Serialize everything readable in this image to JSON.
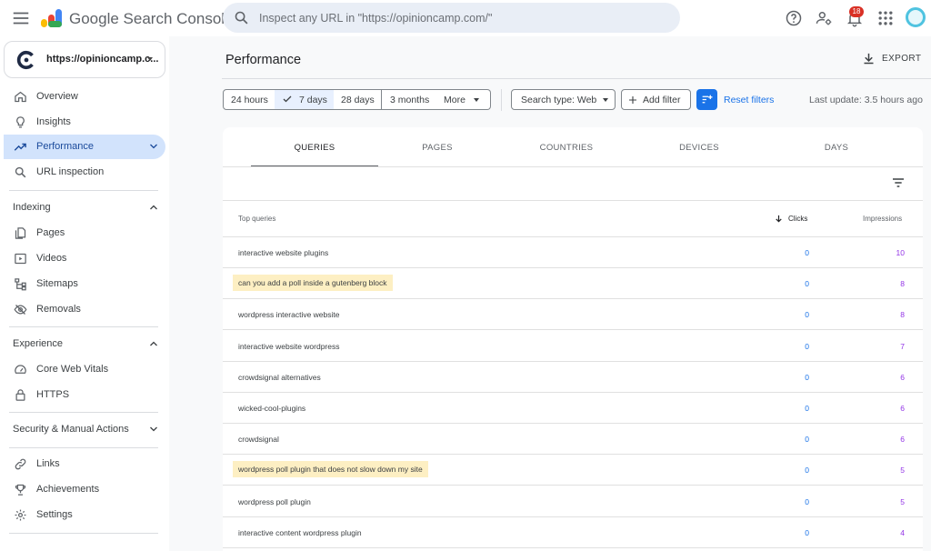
{
  "header": {
    "brand": "Google Search Console",
    "search_placeholder": "Inspect any URL in \"https://opinioncamp.com/\"",
    "notification_count": "18",
    "icons": [
      "menu-icon",
      "help-icon",
      "manage-users-icon",
      "notifications-icon",
      "apps-icon",
      "avatar"
    ]
  },
  "sidebar": {
    "property_label": "https://opinioncamp.c...",
    "items": [
      {
        "label": "Overview",
        "icon": "home-icon"
      },
      {
        "label": "Insights",
        "icon": "insights-icon"
      },
      {
        "label": "Performance",
        "icon": "trending-icon",
        "active": true
      },
      {
        "label": "URL inspection",
        "icon": "search-icon"
      }
    ],
    "sections": [
      {
        "label": "Indexing",
        "items": [
          "Pages",
          "Videos",
          "Sitemaps",
          "Removals"
        ]
      },
      {
        "label": "Experience",
        "items": [
          "Core Web Vitals",
          "HTTPS"
        ]
      },
      {
        "label": "Security & Manual Actions"
      }
    ],
    "bottom_items": [
      "Links",
      "Achievements",
      "Settings"
    ]
  },
  "main": {
    "title": "Performance",
    "export_label": "EXPORT",
    "date_ranges": [
      "24 hours",
      "7 days",
      "28 days",
      "3 months",
      "More"
    ],
    "selected_range": "7 days",
    "search_type": "Search type: Web",
    "add_filter": "Add filter",
    "reset_filters": "Reset filters",
    "last_update": "Last update: 3.5 hours ago"
  },
  "table": {
    "tabs": [
      "QUERIES",
      "PAGES",
      "COUNTRIES",
      "DEVICES",
      "DAYS"
    ],
    "active_tab": "QUERIES",
    "columns": [
      "Top queries",
      "Clicks",
      "Impressions"
    ],
    "rows": [
      {
        "query": "interactive website plugins",
        "clicks": "0",
        "impressions": "10"
      },
      {
        "query": "can you add a poll inside a gutenberg block",
        "clicks": "0",
        "impressions": "8",
        "highlight": true
      },
      {
        "query": "wordpress interactive website",
        "clicks": "0",
        "impressions": "8"
      },
      {
        "query": "interactive website wordpress",
        "clicks": "0",
        "impressions": "7"
      },
      {
        "query": "crowdsignal alternatives",
        "clicks": "0",
        "impressions": "6"
      },
      {
        "query": "wicked-cool-plugins",
        "clicks": "0",
        "impressions": "6"
      },
      {
        "query": "crowdsignal",
        "clicks": "0",
        "impressions": "6"
      },
      {
        "query": "wordpress poll plugin that does not slow down my site",
        "clicks": "0",
        "impressions": "5",
        "highlight": true
      },
      {
        "query": "wordpress poll plugin",
        "clicks": "0",
        "impressions": "5"
      },
      {
        "query": "interactive content wordpress plugin",
        "clicks": "0",
        "impressions": "4"
      }
    ]
  },
  "colors": {
    "accent": "#1a73e8",
    "impressions": "#9334e6",
    "active_nav": "#d2e3fc",
    "highlight": "#fdefc3",
    "badge": "#d93025"
  }
}
